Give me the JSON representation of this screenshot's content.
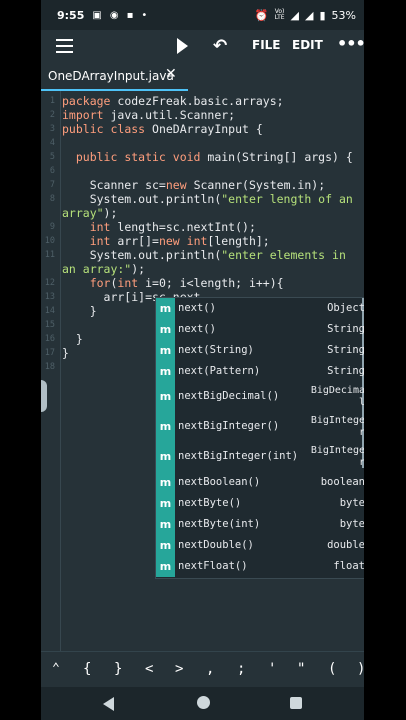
{
  "status": {
    "time": "9:55",
    "battery": "53%",
    "network": "Vo) LTE",
    "lte_line1": "Vo)",
    "lte_line2": "LTE"
  },
  "toolbar": {
    "file_label": "FILE",
    "edit_label": "EDIT"
  },
  "tab": {
    "title": "OneDArrayInput.java"
  },
  "editor": {
    "line_numbers": [
      "1",
      "2",
      "3",
      "4",
      "5",
      "6",
      "7",
      "8",
      "",
      "9",
      "10",
      "11",
      "",
      "12",
      "13",
      "14",
      "15",
      "16",
      "17",
      "18"
    ],
    "code": {
      "l1_kw": "package",
      "l1_rest": " codezFreak.basic.arrays;",
      "l2_kw": "import",
      "l2_rest": " java.util.Scanner;",
      "l3_kw1": "public",
      "l3_kw2": " class",
      "l3_rest": " OneDArrayInput {",
      "l5_kw1": "  public",
      "l5_kw2": " static",
      "l5_kw3": " void",
      "l5_rest": " main(String[] args) {",
      "l7_a": "    Scanner sc=",
      "l7_kw": "new",
      "l7_b": " Scanner(System.in);",
      "l8_a": "    System.out.println(",
      "l8_str": "\"enter length of an",
      "l8w_str": "array\"",
      "l8w_b": ");",
      "l9_kw": "    int",
      "l9_b": " length=sc.nextInt();",
      "l10_kw": "    int",
      "l10_b": " arr[]=",
      "l10_kw2": "new",
      "l10_kw3": " int",
      "l10_c": "[length];",
      "l11_a": "    System.out.println(",
      "l11_str": "\"enter elements in",
      "l11w_str": "an array:\"",
      "l11w_b": ");",
      "l12_kw": "    for",
      "l12_a": "(",
      "l12_kw2": "int",
      "l12_b": " i=0; i<length; i++){",
      "l13": "      arr[i]=sc.next",
      "l14": "    }",
      "l16": "  }",
      "l17": "}"
    }
  },
  "autocomplete": {
    "items": [
      {
        "icon": "m",
        "name": "next()",
        "type": "Object"
      },
      {
        "icon": "m",
        "name": "next()",
        "type": "String"
      },
      {
        "icon": "m",
        "name": "next(String)",
        "type": "String"
      },
      {
        "icon": "m",
        "name": "next(Pattern)",
        "type": "String"
      },
      {
        "icon": "m",
        "name": "nextBigDecimal()",
        "type_line1": "BigDecima",
        "type_line2": "l"
      },
      {
        "icon": "m",
        "name": "nextBigInteger()",
        "type_line1": "BigIntege",
        "type_line2": "r"
      },
      {
        "icon": "m",
        "name": "nextBigInteger(int)",
        "type_line1": "BigIntege",
        "type_line2": "r"
      },
      {
        "icon": "m",
        "name": "nextBoolean()",
        "type": "boolean"
      },
      {
        "icon": "m",
        "name": "nextByte()",
        "type": "byte"
      },
      {
        "icon": "m",
        "name": "nextByte(int)",
        "type": "byte"
      },
      {
        "icon": "m",
        "name": "nextDouble()",
        "type": "double"
      },
      {
        "icon": "m",
        "name": "nextFloat()",
        "type": "float"
      }
    ]
  },
  "symbols": [
    "{",
    "}",
    "<",
    ">",
    ",",
    ";",
    "'",
    "\"",
    "(",
    ")"
  ],
  "colors": {
    "background": "#263238",
    "accent": "#4fc3f7",
    "method_badge": "#26a69a",
    "keyword": "#ff9e7d",
    "string": "#b5e07a"
  }
}
